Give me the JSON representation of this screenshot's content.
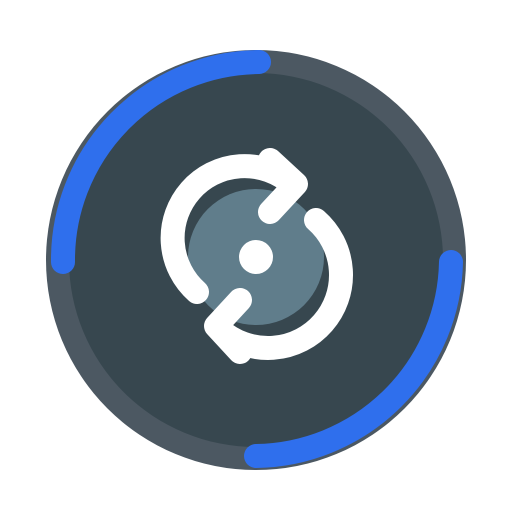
{
  "icon": {
    "name": "sync-cleaner-app-icon",
    "colors": {
      "background": "#ffffff",
      "outer_ring": "#4c5862",
      "inner_disc": "#37474f",
      "progress_arc": "#2f6fed",
      "center_disc": "#607d8b",
      "arrows": "#ffffff"
    }
  }
}
